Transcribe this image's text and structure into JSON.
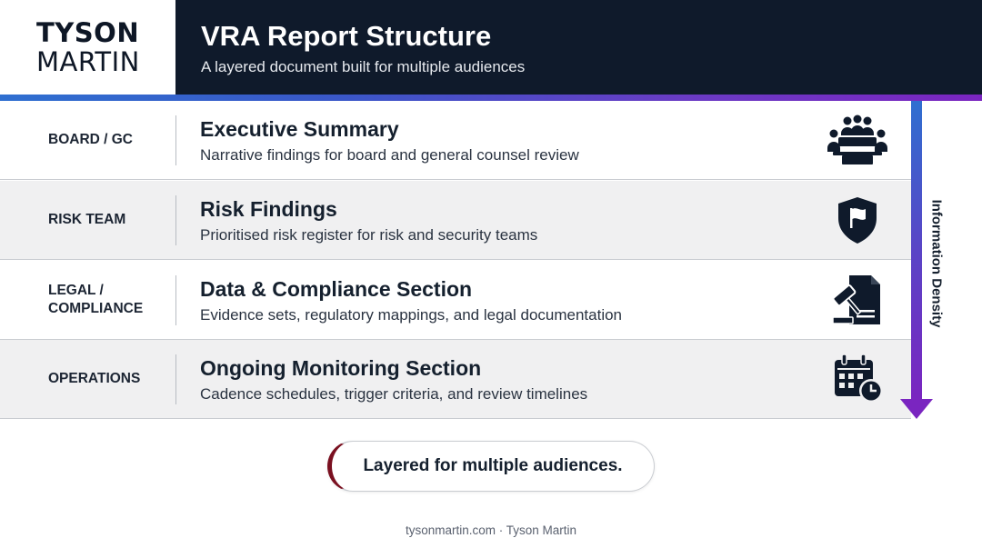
{
  "brand": {
    "line1": "TYSON",
    "line2": "MARTIN"
  },
  "header": {
    "title": "VRA Report Structure",
    "subtitle": "A layered document built for multiple audiences"
  },
  "rows": [
    {
      "audience": "BOARD / GC",
      "title": "Executive Summary",
      "description": "Narrative findings for board and general counsel review",
      "icon": "boardroom-meeting-icon"
    },
    {
      "audience": "RISK TEAM",
      "title": "Risk Findings",
      "description": "Prioritised risk register for risk and security teams",
      "icon": "shield-flag-icon"
    },
    {
      "audience": "LEGAL / COMPLIANCE",
      "title": "Data & Compliance Section",
      "description": "Evidence sets, regulatory mappings, and legal documentation",
      "icon": "gavel-document-icon"
    },
    {
      "audience": "OPERATIONS",
      "title": "Ongoing Monitoring Section",
      "description": "Cadence schedules, trigger criteria, and review timelines",
      "icon": "calendar-clock-icon"
    }
  ],
  "arrow": {
    "label": "Information Density"
  },
  "callout": {
    "text": "Layered for multiple audiences."
  },
  "footer": {
    "text": "tysonmartin.com · Tyson Martin"
  },
  "colors": {
    "header_bg": "#0f1a2b",
    "accent_start": "#2f6fd0",
    "accent_end": "#7a25c0",
    "callout_accent": "#7a1020",
    "row_alt_bg": "#f0f0f1"
  }
}
